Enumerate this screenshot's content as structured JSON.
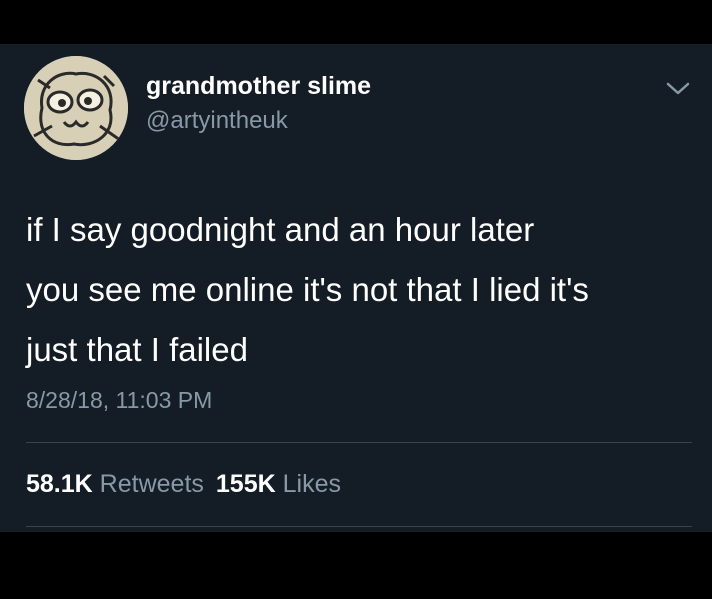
{
  "user": {
    "display_name": "grandmother slime",
    "handle": "@artyintheuk",
    "avatar": "doodle-face-avatar"
  },
  "menu_icon": "chevron-down-icon",
  "tweet": {
    "lines": [
      "if I say goodnight and an hour later",
      "you see me online it's not that I lied it's",
      "just that I failed"
    ],
    "timestamp": "8/28/18, 11:03 PM"
  },
  "stats": {
    "retweets_count": "58.1K",
    "retweets_label": "Retweets",
    "likes_count": "155K",
    "likes_label": "Likes"
  },
  "colors": {
    "background": "#141d26",
    "text": "#ffffff",
    "muted": "#8899a6",
    "divider": "#38444d"
  }
}
